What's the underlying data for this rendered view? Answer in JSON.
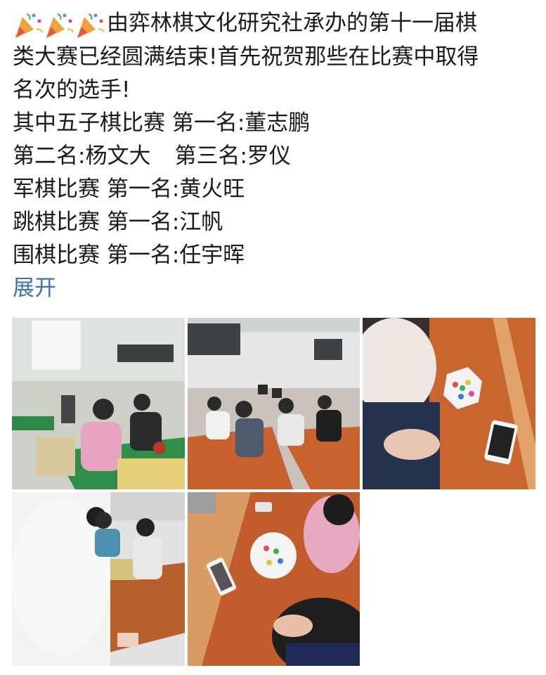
{
  "post": {
    "lines": [
      "由弈林棋文化研究社承办的第十一届棋",
      "类大赛已经圆满结束!首先祝贺那些在比赛中取得",
      "名次的选手!",
      "其中五子棋比赛 第一名:董志鹏",
      "第二名:杨文大",
      "第三名:罗仪",
      "军棋比赛 第一名:黄火旺",
      "跳棋比赛 第一名:江帆",
      "围棋比赛 第一名:任宇晖"
    ],
    "emoji_icons": [
      "party-popper-icon",
      "party-popper-icon",
      "party-popper-icon"
    ],
    "expand_label": "展开"
  },
  "photos": {
    "count": 5,
    "items": [
      {
        "name": "photo-gomoku-hall"
      },
      {
        "name": "photo-classroom-players"
      },
      {
        "name": "photo-chinese-checkers-closeup"
      },
      {
        "name": "photo-go-match"
      },
      {
        "name": "photo-checkers-table"
      }
    ]
  },
  "colors": {
    "link": "#3f6fb6",
    "text": "#1a1a1a",
    "table_orange": "#c96a3a"
  }
}
